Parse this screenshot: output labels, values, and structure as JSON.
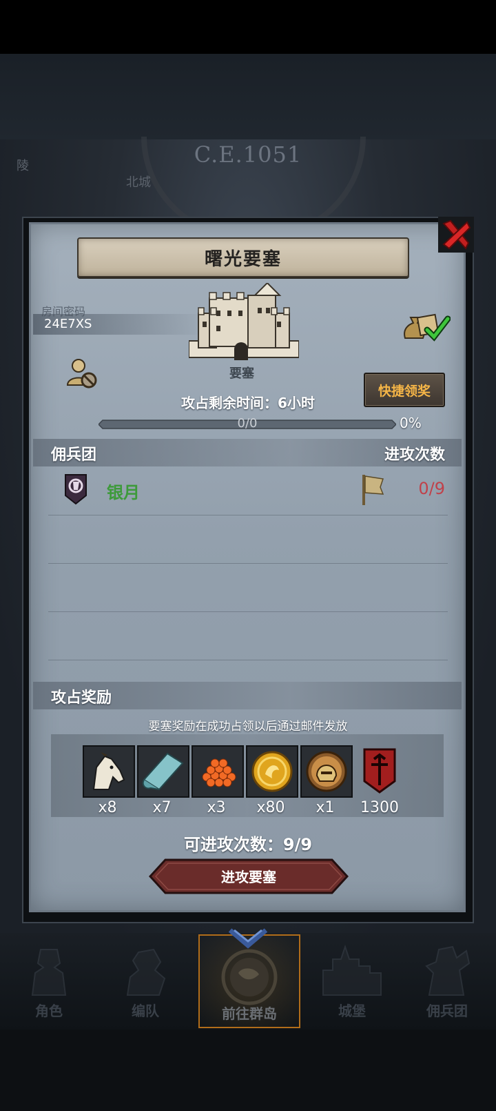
{
  "background": {
    "era_title": "C.E.1051",
    "left_label": "陵",
    "north_city_label": "北城"
  },
  "dialog": {
    "title": "曙光要塞",
    "room_code_label": "房间密码",
    "room_code": "24E7XS",
    "fortress_label": "要塞",
    "claim_button": "快捷领奖",
    "time_remaining": "攻占剩余时间：6小时",
    "progress_text": "0/0",
    "progress_value": 0,
    "progress_percent": "0%",
    "mercenary_header": "佣兵团",
    "attack_count_header": "进攻次数",
    "guild": {
      "name": "银月",
      "attack_count": "0/9"
    },
    "rewards": {
      "header": "攻占奖励",
      "note": "要塞奖励在成功占领以后通过邮件发放",
      "items": [
        {
          "icon": "horse-icon",
          "qty": "x8"
        },
        {
          "icon": "cloth-icon",
          "qty": "x7"
        },
        {
          "icon": "roe-icon",
          "qty": "x3"
        },
        {
          "icon": "gold-coin-icon",
          "qty": "x80"
        },
        {
          "icon": "helmet-medal-icon",
          "qty": "x1"
        },
        {
          "icon": "guild-banner-icon",
          "qty": "1300"
        }
      ]
    },
    "attacks_available": "可进攻次数：9/9",
    "attack_button": "进攻要塞"
  },
  "nav": {
    "items": [
      {
        "label": "角色",
        "icon": "character-icon"
      },
      {
        "label": "编队",
        "icon": "formation-icon"
      },
      {
        "label": "前往群岛",
        "icon": "island-icon",
        "active": true
      },
      {
        "label": "城堡",
        "icon": "castle-icon"
      },
      {
        "label": "佣兵团",
        "icon": "mercenary-icon"
      }
    ]
  },
  "colors": {
    "accent_gold": "#f5b547",
    "guild_green": "#3d9a3a",
    "count_red": "#c0414a",
    "nav_active_border": "#b16d1a"
  }
}
